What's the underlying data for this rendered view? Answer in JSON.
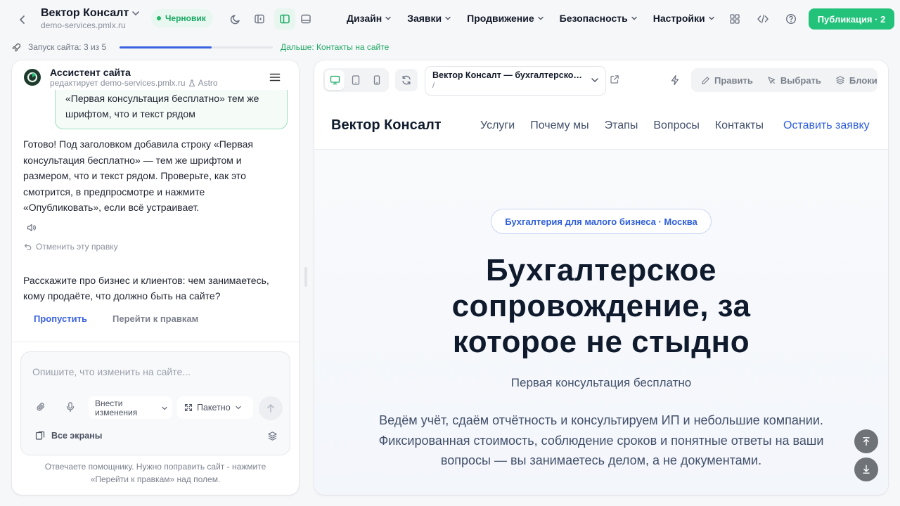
{
  "topbar": {
    "site_name": "Вектор Консалт",
    "site_domain": "demo-services.pmlx.ru",
    "status_badge": "Черновик",
    "menu": [
      {
        "label": "Дизайн"
      },
      {
        "label": "Заявки"
      },
      {
        "label": "Продвижение"
      },
      {
        "label": "Безопасность"
      },
      {
        "label": "Настройки"
      }
    ],
    "publish_label": "Публикация · 2"
  },
  "progress": {
    "label": "Запуск сайта: 3 из 5",
    "current": 3,
    "total": 5,
    "next_label": "Дальше: Контакты на сайте"
  },
  "assistant": {
    "title": "Ассистент сайта",
    "subtitle": "редактирует demo-services.pmlx.ru",
    "model": "Astro",
    "user_message": "«Первая консультация бесплатно» тем же шрифтом, что и текст рядом",
    "reply": "Готово! Под заголовком добавила строку «Первая консультация бесплатно» — тем же шрифтом и размером, что и текст рядом. Проверьте, как это смотрится, в предпросмотре и нажмите «Опубликовать», если всё устраивает.",
    "undo_label": "Отменить эту правку",
    "question": "Расскажите про бизнес и клиентов: чем занимаетесь, кому продаёте, что должно быть на сайте?",
    "skip_label": "Пропустить",
    "goto_label": "Перейти к правкам",
    "composer": {
      "placeholder": "Опишите, что изменить на сайте...",
      "mode_label": "Внести изменения",
      "batch_label": "Пакетно",
      "screens_label": "Все экраны"
    },
    "hint": "Отвечаете помощнику. Нужно поправить сайт - нажмите «Перейти к правкам» над полем."
  },
  "preview": {
    "url_title": "Вектор Консалт — бухгалтерское сопровождение",
    "url_path": "/",
    "toolbar": {
      "edit_label": "Править",
      "select_label": "Выбрать",
      "blocks_label": "Блоки"
    },
    "site": {
      "logo": "Вектор Консалт",
      "nav": [
        "Услуги",
        "Почему мы",
        "Этапы",
        "Вопросы",
        "Контакты"
      ],
      "cta": "Оставить заявку",
      "badge": "Бухгалтерия для малого бизнеса · Москва",
      "title": "Бухгалтерское сопровождение, за которое не стыдно",
      "subtitle": "Первая консультация бесплатно",
      "description": "Ведём учёт, сдаём отчётность и консультируем ИП и небольшие компании. Фиксированная стоимость, соблюдение сроков и понятные ответы на ваши вопросы — вы занимаетесь делом, а не документами."
    }
  },
  "colors": {
    "accent_green": "#22c27a",
    "accent_blue": "#3b62e0",
    "site_blue": "#2f5fd8",
    "dark_text": "#0f1b2d"
  },
  "icons": {
    "back": "chevron-left-icon",
    "theme": "moon-icon",
    "panel_left": "sidebar-left-icon",
    "panel_split": "split-view-icon",
    "panel_bottom": "panel-bottom-icon",
    "apps": "grid-icon",
    "code": "code-icon",
    "help": "help-icon",
    "launch": "rocket-icon"
  }
}
